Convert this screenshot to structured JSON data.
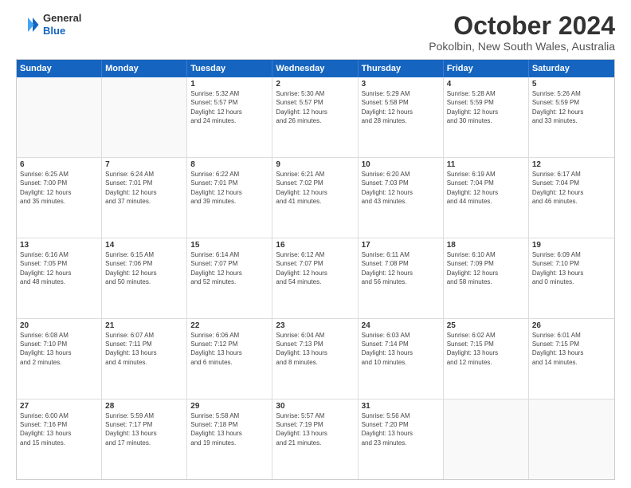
{
  "logo": {
    "line1": "General",
    "line2": "Blue"
  },
  "title": "October 2024",
  "location": "Pokolbin, New South Wales, Australia",
  "days_header": [
    "Sunday",
    "Monday",
    "Tuesday",
    "Wednesday",
    "Thursday",
    "Friday",
    "Saturday"
  ],
  "weeks": [
    [
      {
        "day": "",
        "info": ""
      },
      {
        "day": "",
        "info": ""
      },
      {
        "day": "1",
        "info": "Sunrise: 5:32 AM\nSunset: 5:57 PM\nDaylight: 12 hours\nand 24 minutes."
      },
      {
        "day": "2",
        "info": "Sunrise: 5:30 AM\nSunset: 5:57 PM\nDaylight: 12 hours\nand 26 minutes."
      },
      {
        "day": "3",
        "info": "Sunrise: 5:29 AM\nSunset: 5:58 PM\nDaylight: 12 hours\nand 28 minutes."
      },
      {
        "day": "4",
        "info": "Sunrise: 5:28 AM\nSunset: 5:59 PM\nDaylight: 12 hours\nand 30 minutes."
      },
      {
        "day": "5",
        "info": "Sunrise: 5:26 AM\nSunset: 5:59 PM\nDaylight: 12 hours\nand 33 minutes."
      }
    ],
    [
      {
        "day": "6",
        "info": "Sunrise: 6:25 AM\nSunset: 7:00 PM\nDaylight: 12 hours\nand 35 minutes."
      },
      {
        "day": "7",
        "info": "Sunrise: 6:24 AM\nSunset: 7:01 PM\nDaylight: 12 hours\nand 37 minutes."
      },
      {
        "day": "8",
        "info": "Sunrise: 6:22 AM\nSunset: 7:01 PM\nDaylight: 12 hours\nand 39 minutes."
      },
      {
        "day": "9",
        "info": "Sunrise: 6:21 AM\nSunset: 7:02 PM\nDaylight: 12 hours\nand 41 minutes."
      },
      {
        "day": "10",
        "info": "Sunrise: 6:20 AM\nSunset: 7:03 PM\nDaylight: 12 hours\nand 43 minutes."
      },
      {
        "day": "11",
        "info": "Sunrise: 6:19 AM\nSunset: 7:04 PM\nDaylight: 12 hours\nand 44 minutes."
      },
      {
        "day": "12",
        "info": "Sunrise: 6:17 AM\nSunset: 7:04 PM\nDaylight: 12 hours\nand 46 minutes."
      }
    ],
    [
      {
        "day": "13",
        "info": "Sunrise: 6:16 AM\nSunset: 7:05 PM\nDaylight: 12 hours\nand 48 minutes."
      },
      {
        "day": "14",
        "info": "Sunrise: 6:15 AM\nSunset: 7:06 PM\nDaylight: 12 hours\nand 50 minutes."
      },
      {
        "day": "15",
        "info": "Sunrise: 6:14 AM\nSunset: 7:07 PM\nDaylight: 12 hours\nand 52 minutes."
      },
      {
        "day": "16",
        "info": "Sunrise: 6:12 AM\nSunset: 7:07 PM\nDaylight: 12 hours\nand 54 minutes."
      },
      {
        "day": "17",
        "info": "Sunrise: 6:11 AM\nSunset: 7:08 PM\nDaylight: 12 hours\nand 56 minutes."
      },
      {
        "day": "18",
        "info": "Sunrise: 6:10 AM\nSunset: 7:09 PM\nDaylight: 12 hours\nand 58 minutes."
      },
      {
        "day": "19",
        "info": "Sunrise: 6:09 AM\nSunset: 7:10 PM\nDaylight: 13 hours\nand 0 minutes."
      }
    ],
    [
      {
        "day": "20",
        "info": "Sunrise: 6:08 AM\nSunset: 7:10 PM\nDaylight: 13 hours\nand 2 minutes."
      },
      {
        "day": "21",
        "info": "Sunrise: 6:07 AM\nSunset: 7:11 PM\nDaylight: 13 hours\nand 4 minutes."
      },
      {
        "day": "22",
        "info": "Sunrise: 6:06 AM\nSunset: 7:12 PM\nDaylight: 13 hours\nand 6 minutes."
      },
      {
        "day": "23",
        "info": "Sunrise: 6:04 AM\nSunset: 7:13 PM\nDaylight: 13 hours\nand 8 minutes."
      },
      {
        "day": "24",
        "info": "Sunrise: 6:03 AM\nSunset: 7:14 PM\nDaylight: 13 hours\nand 10 minutes."
      },
      {
        "day": "25",
        "info": "Sunrise: 6:02 AM\nSunset: 7:15 PM\nDaylight: 13 hours\nand 12 minutes."
      },
      {
        "day": "26",
        "info": "Sunrise: 6:01 AM\nSunset: 7:15 PM\nDaylight: 13 hours\nand 14 minutes."
      }
    ],
    [
      {
        "day": "27",
        "info": "Sunrise: 6:00 AM\nSunset: 7:16 PM\nDaylight: 13 hours\nand 15 minutes."
      },
      {
        "day": "28",
        "info": "Sunrise: 5:59 AM\nSunset: 7:17 PM\nDaylight: 13 hours\nand 17 minutes."
      },
      {
        "day": "29",
        "info": "Sunrise: 5:58 AM\nSunset: 7:18 PM\nDaylight: 13 hours\nand 19 minutes."
      },
      {
        "day": "30",
        "info": "Sunrise: 5:57 AM\nSunset: 7:19 PM\nDaylight: 13 hours\nand 21 minutes."
      },
      {
        "day": "31",
        "info": "Sunrise: 5:56 AM\nSunset: 7:20 PM\nDaylight: 13 hours\nand 23 minutes."
      },
      {
        "day": "",
        "info": ""
      },
      {
        "day": "",
        "info": ""
      }
    ]
  ]
}
